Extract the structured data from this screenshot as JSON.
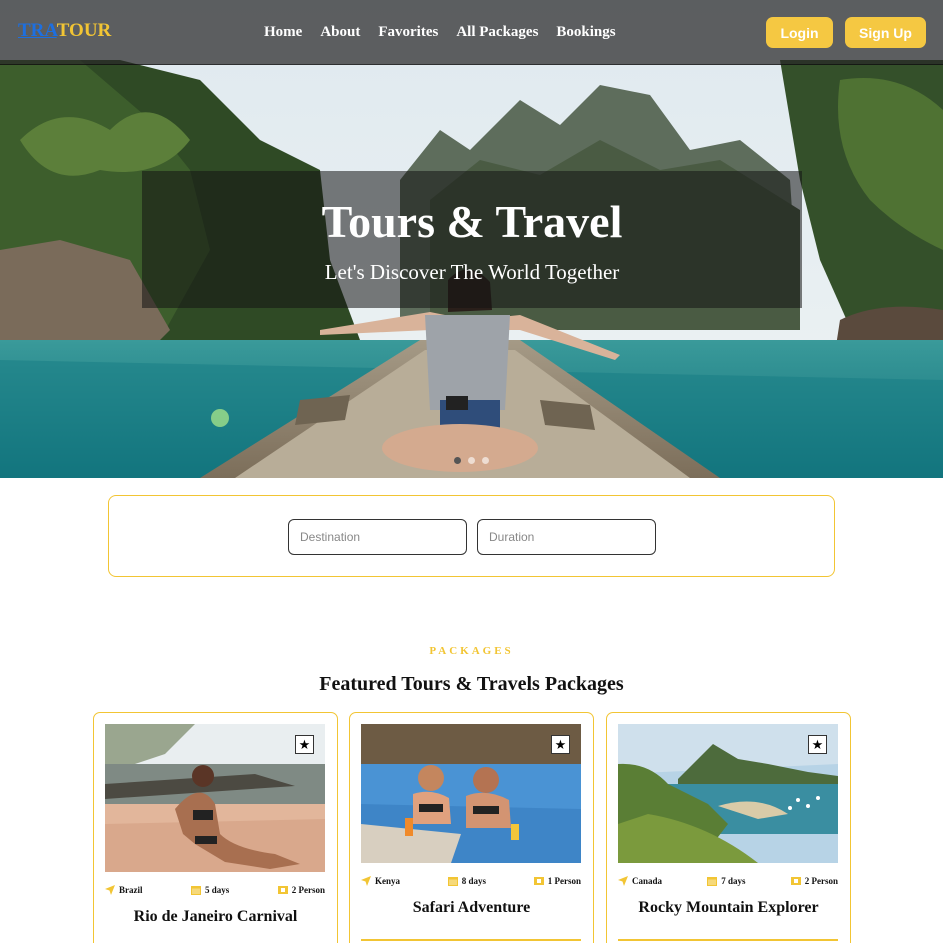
{
  "brand": {
    "part1": "TRA",
    "part2": "TOUR"
  },
  "nav": {
    "links": [
      "Home",
      "About",
      "Favorites",
      "All Packages",
      "Bookings"
    ],
    "login_label": "Login",
    "signup_label": "Sign Up"
  },
  "hero": {
    "title": "Tours & Travel",
    "subtitle": "Let's Discover The World Together",
    "slides": 3,
    "active_slide": 1
  },
  "search": {
    "destination_placeholder": "Destination",
    "duration_placeholder": "Duration"
  },
  "section": {
    "label": "PACKAGES",
    "title": "Featured Tours & Travels Packages"
  },
  "packages": [
    {
      "location": "Brazil",
      "duration": "5 days",
      "people": "2 Person",
      "title": "Rio de Janeiro Carnival"
    },
    {
      "location": "Kenya",
      "duration": "8 days",
      "people": "1 Person",
      "title": "Safari Adventure"
    },
    {
      "location": "Canada",
      "duration": "7 days",
      "people": "2 Person",
      "title": "Rocky Mountain Explorer"
    }
  ],
  "colors": {
    "accent": "#f2c534",
    "brand_blue": "#1d6fe0",
    "nav_bg": "#2a2a2a"
  },
  "icons": {
    "location": "location-arrow-icon",
    "duration": "calendar-icon",
    "people": "ticket-icon",
    "favorite": "star-icon"
  }
}
